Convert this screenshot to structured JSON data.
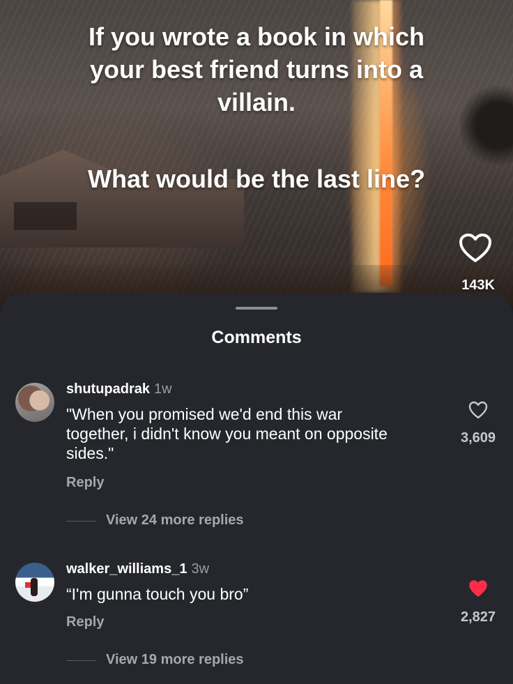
{
  "post": {
    "caption_line1": "If you wrote a book in which",
    "caption_line2": "your best friend turns into a",
    "caption_line3": "villain.",
    "caption_line4": "What would be the last line?",
    "likes": "143K",
    "like_icon": "heart-outline-icon"
  },
  "comments_sheet": {
    "title": "Comments",
    "comments": [
      {
        "username": "shutupadrak",
        "time": "1w",
        "text_line1": "\"When you promised we'd end this war",
        "text_line2": "together, i didn't know you meant on opposite",
        "text_line3": "sides.\"",
        "reply_label": "Reply",
        "view_replies": "View 24 more replies",
        "likes": "3,609",
        "liked": false,
        "like_icon": "heart-outline-icon"
      },
      {
        "username": "walker_williams_1",
        "time": "3w",
        "text_line1": "“I'm gunna touch you bro”",
        "reply_label": "Reply",
        "view_replies": "View 19 more replies",
        "likes": "2,827",
        "liked": true,
        "like_icon": "heart-filled-icon",
        "liked_color": "#ff2d4a"
      }
    ]
  }
}
